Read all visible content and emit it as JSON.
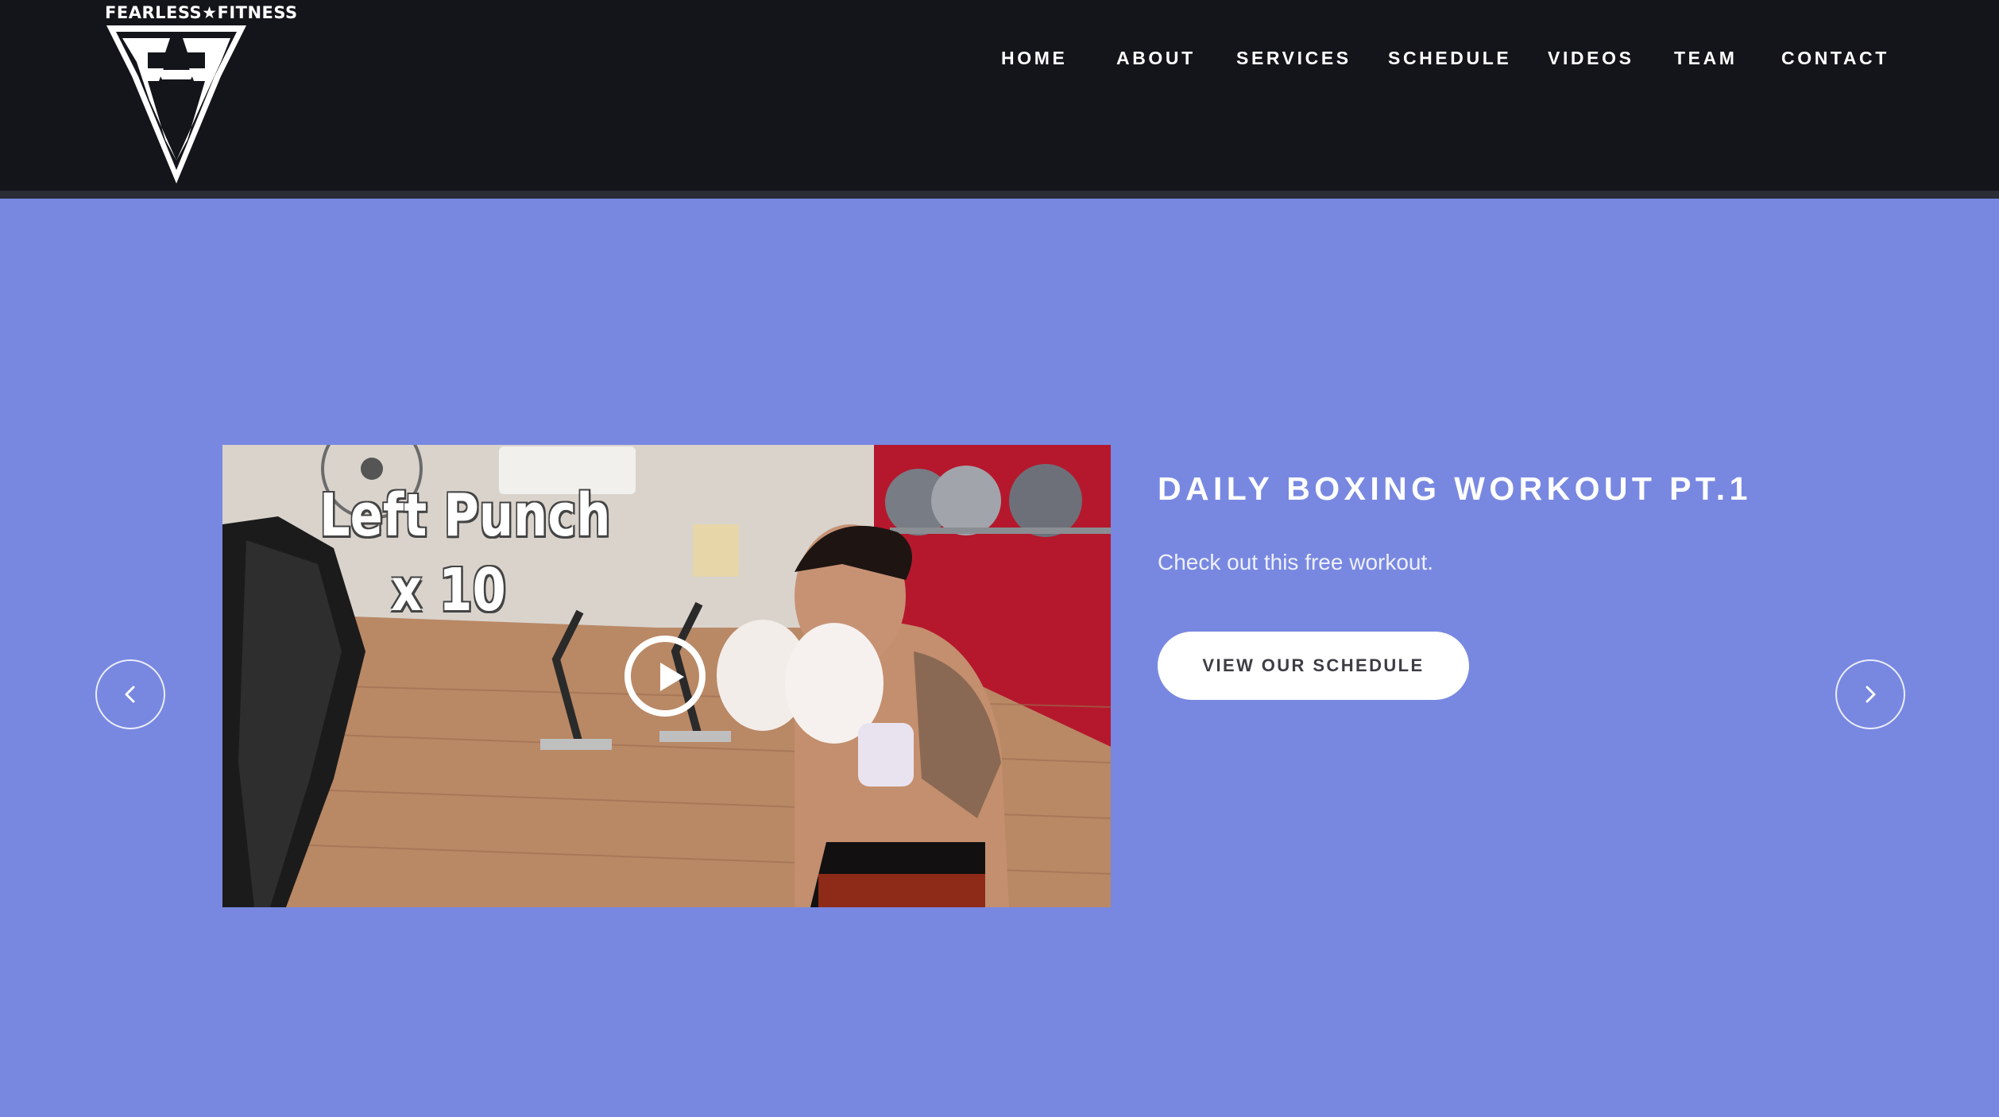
{
  "brand": {
    "logo_text": "FEARLESS★FITNESS",
    "logo_icon": "ff-monogram-shield-logo"
  },
  "nav": {
    "items": [
      {
        "label": "HOME"
      },
      {
        "label": "ABOUT"
      },
      {
        "label": "SERVICES"
      },
      {
        "label": "SCHEDULE"
      },
      {
        "label": "VIDEOS"
      },
      {
        "label": "TEAM"
      },
      {
        "label": "CONTACT"
      }
    ]
  },
  "slide": {
    "title": "DAILY BOXING WORKOUT PT.1",
    "description": "Check out this free workout.",
    "cta_label": "VIEW OUR SCHEDULE",
    "video": {
      "overlay_line1": "Left Punch",
      "overlay_line2": "x 10",
      "play_icon": "play-circle-icon"
    }
  },
  "carousel": {
    "prev_icon": "chevron-left-icon",
    "next_icon": "chevron-right-icon"
  },
  "colors": {
    "header_bg": "#14151a",
    "hero_bg": "#7888e1",
    "button_bg": "#ffffff",
    "button_text": "#3d3d45"
  }
}
